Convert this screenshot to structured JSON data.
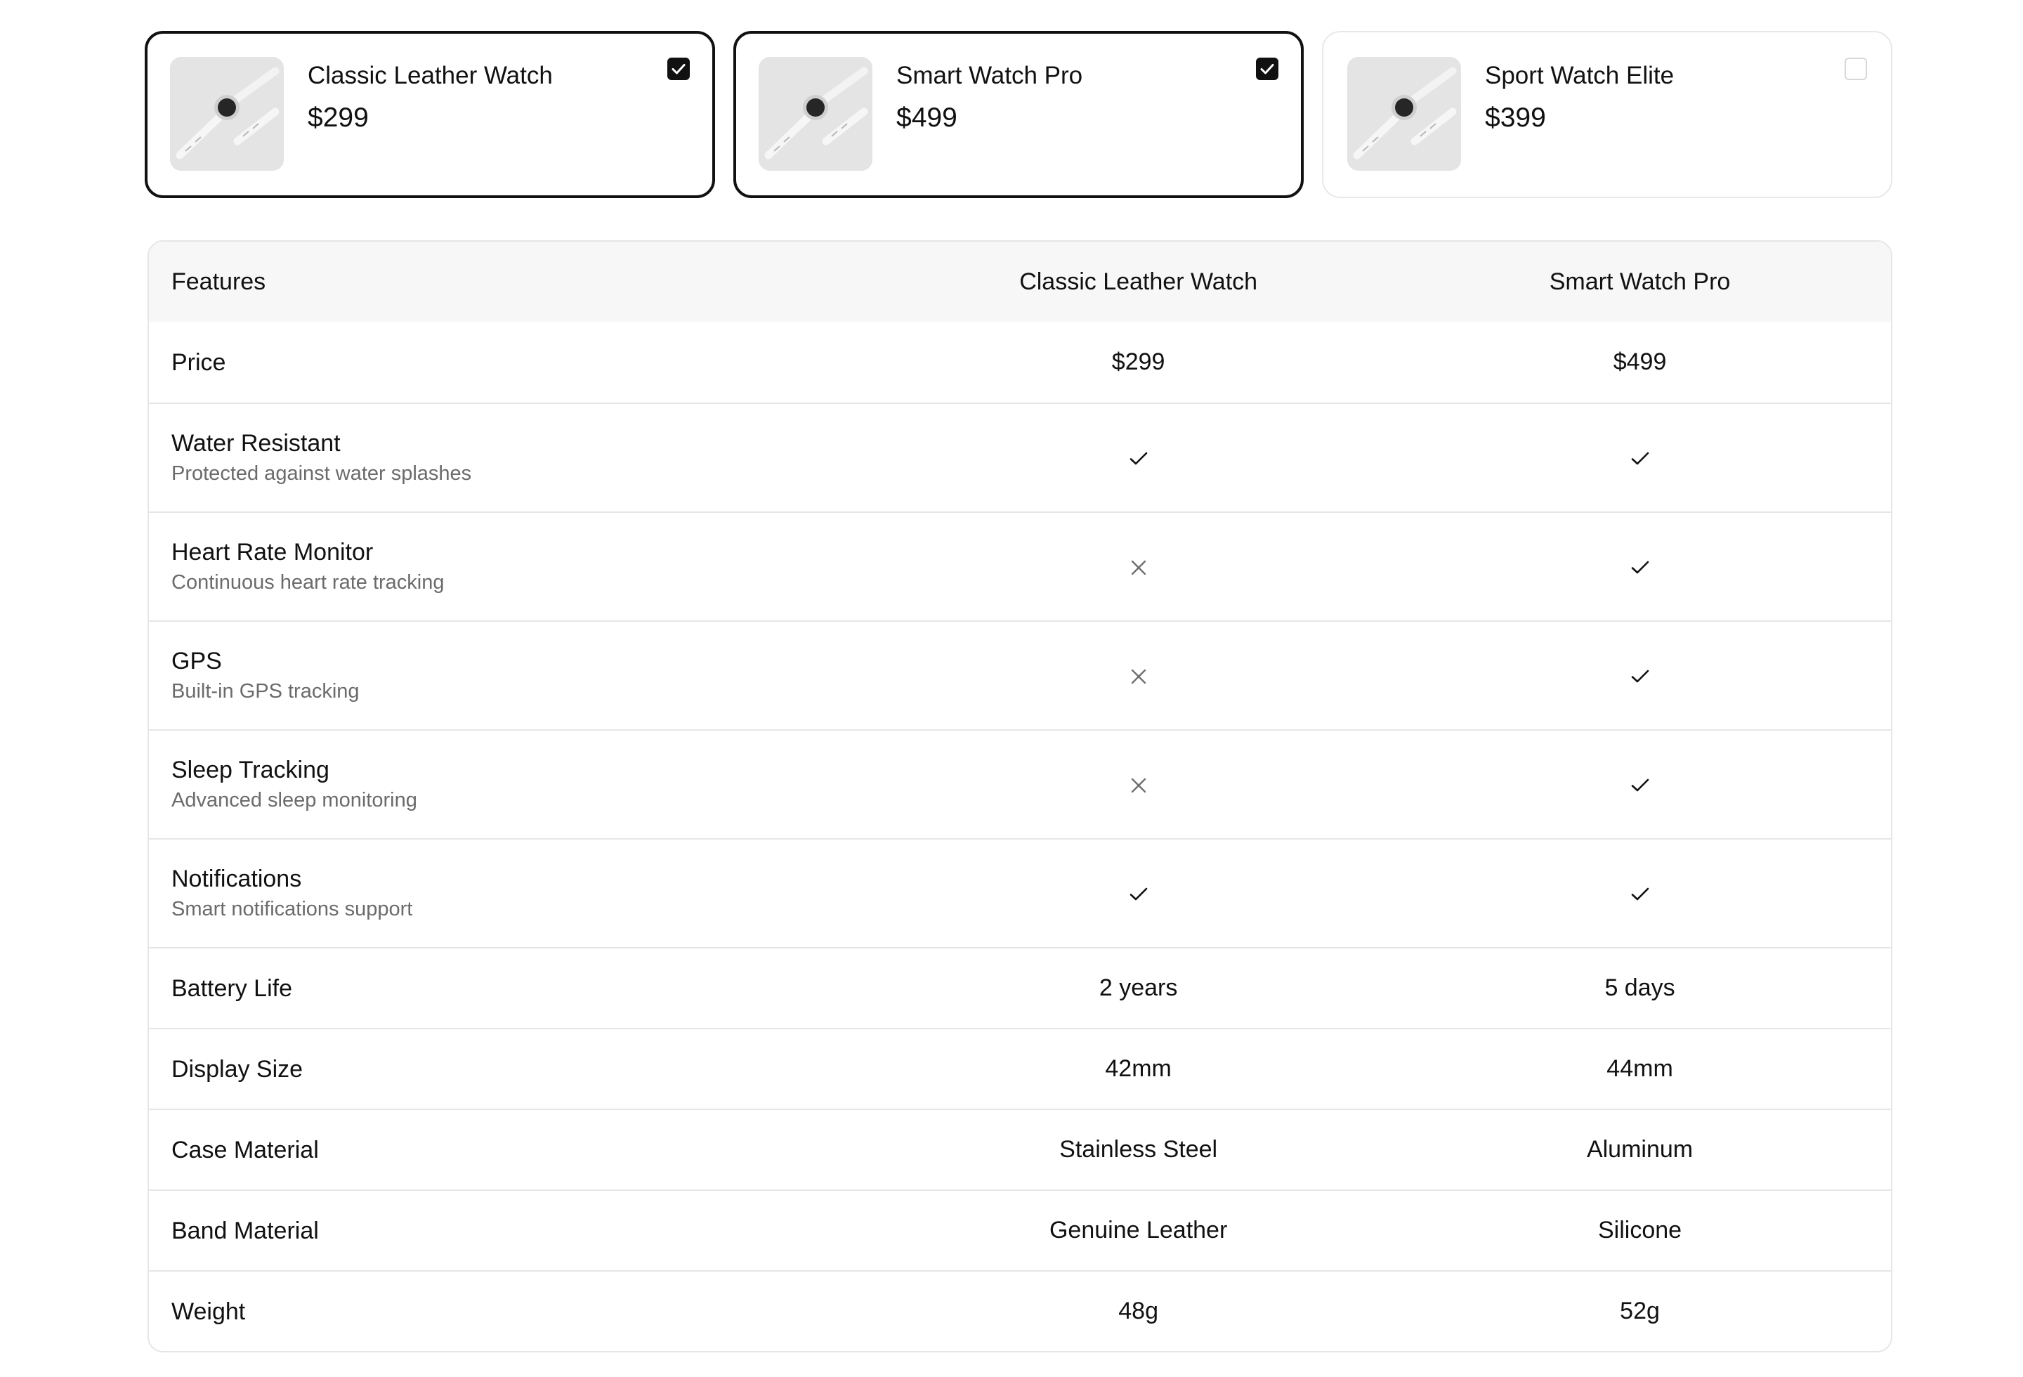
{
  "products": [
    {
      "name": "Classic Leather Watch",
      "price": "$299",
      "selected": true,
      "image_icon": "watch-image"
    },
    {
      "name": "Smart Watch Pro",
      "price": "$499",
      "selected": true,
      "image_icon": "watch-image"
    },
    {
      "name": "Sport Watch Elite",
      "price": "$399",
      "selected": false,
      "image_icon": "watch-image"
    }
  ],
  "table": {
    "header": {
      "feature": "Features",
      "col1": "Classic Leather Watch",
      "col2": "Smart Watch Pro"
    },
    "rows": [
      {
        "title": "Price",
        "desc": "",
        "col1": "$299",
        "col2": "$499"
      },
      {
        "title": "Water Resistant",
        "desc": "Protected against water splashes",
        "col1": "check-icon",
        "col2": "check-icon"
      },
      {
        "title": "Heart Rate Monitor",
        "desc": "Continuous heart rate tracking",
        "col1": "x-icon",
        "col2": "check-icon"
      },
      {
        "title": "GPS",
        "desc": "Built-in GPS tracking",
        "col1": "x-icon",
        "col2": "check-icon"
      },
      {
        "title": "Sleep Tracking",
        "desc": "Advanced sleep monitoring",
        "col1": "x-icon",
        "col2": "check-icon"
      },
      {
        "title": "Notifications",
        "desc": "Smart notifications support",
        "col1": "check-icon",
        "col2": "check-icon"
      },
      {
        "title": "Battery Life",
        "desc": "",
        "col1": "2 years",
        "col2": "5 days"
      },
      {
        "title": "Display Size",
        "desc": "",
        "col1": "42mm",
        "col2": "44mm"
      },
      {
        "title": "Case Material",
        "desc": "",
        "col1": "Stainless Steel",
        "col2": "Aluminum"
      },
      {
        "title": "Band Material",
        "desc": "",
        "col1": "Genuine Leather",
        "col2": "Silicone"
      },
      {
        "title": "Weight",
        "desc": "",
        "col1": "48g",
        "col2": "52g"
      }
    ]
  },
  "colors": {
    "selected_border": "#111111",
    "card_border": "#e8e8e8",
    "header_bg": "#f7f7f7",
    "muted_text": "#6b6b6b",
    "x_icon": "#6f6f6f"
  }
}
